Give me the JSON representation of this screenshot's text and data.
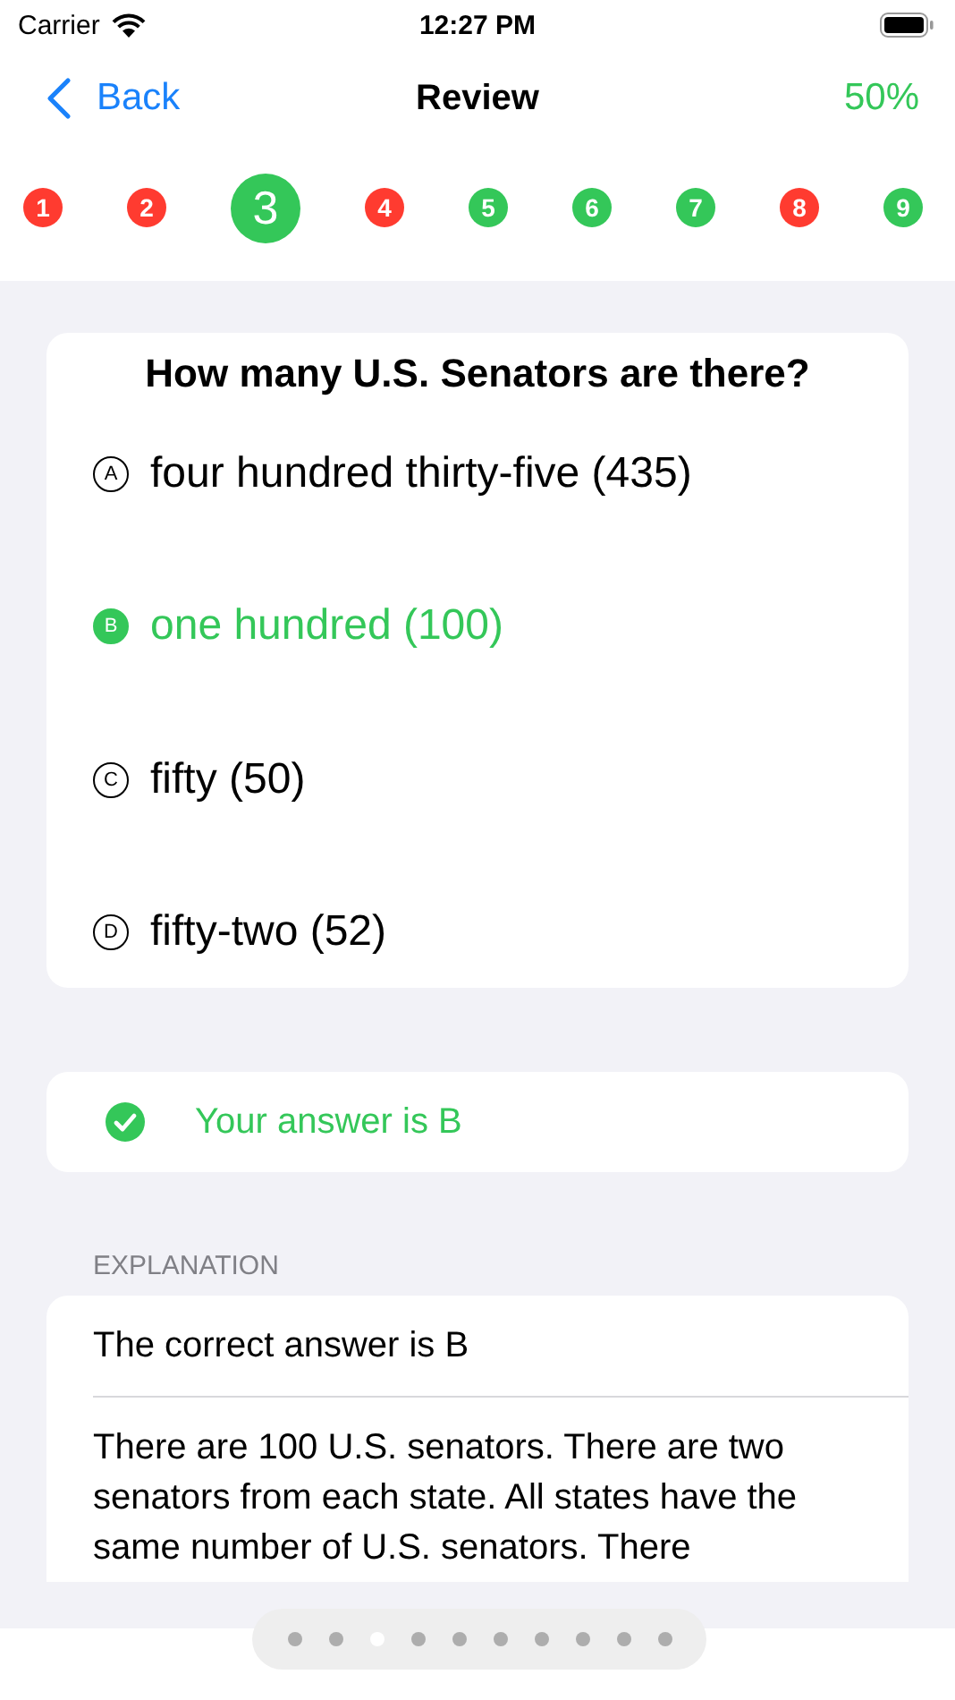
{
  "status_bar": {
    "carrier": "Carrier",
    "time": "12:27 PM"
  },
  "nav": {
    "back": "Back",
    "title": "Review",
    "score": "50%"
  },
  "questions": [
    {
      "label": "1",
      "color": "#ff3b30",
      "selected": false
    },
    {
      "label": "2",
      "color": "#ff3b30",
      "selected": false
    },
    {
      "label": "3",
      "color": "#34c759",
      "selected": true
    },
    {
      "label": "4",
      "color": "#ff3b30",
      "selected": false
    },
    {
      "label": "5",
      "color": "#34c759",
      "selected": false
    },
    {
      "label": "6",
      "color": "#34c759",
      "selected": false
    },
    {
      "label": "7",
      "color": "#34c759",
      "selected": false
    },
    {
      "label": "8",
      "color": "#ff3b30",
      "selected": false
    },
    {
      "label": "9",
      "color": "#34c759",
      "selected": false
    }
  ],
  "question": {
    "text": "How many U.S. Senators are there?",
    "options": [
      {
        "letter": "A",
        "text": "four hundred thirty-five (435)",
        "selected": false
      },
      {
        "letter": "B",
        "text": "one hundred (100)",
        "selected": true
      },
      {
        "letter": "C",
        "text": "fifty (50)",
        "selected": false
      },
      {
        "letter": "D",
        "text": "fifty-two (52)",
        "selected": false
      }
    ]
  },
  "result": {
    "text": "Your answer is B",
    "correct": true
  },
  "explanation": {
    "heading": "EXPLANATION",
    "title": "The correct answer is B",
    "body": "There are 100 U.S. senators. There are two senators from each state. All states have the same number of U.S. senators. There"
  },
  "pages": [
    {
      "selected": false
    },
    {
      "selected": false
    },
    {
      "selected": true
    },
    {
      "selected": false
    },
    {
      "selected": false
    },
    {
      "selected": false
    },
    {
      "selected": false
    },
    {
      "selected": false
    },
    {
      "selected": false
    },
    {
      "selected": false
    }
  ]
}
